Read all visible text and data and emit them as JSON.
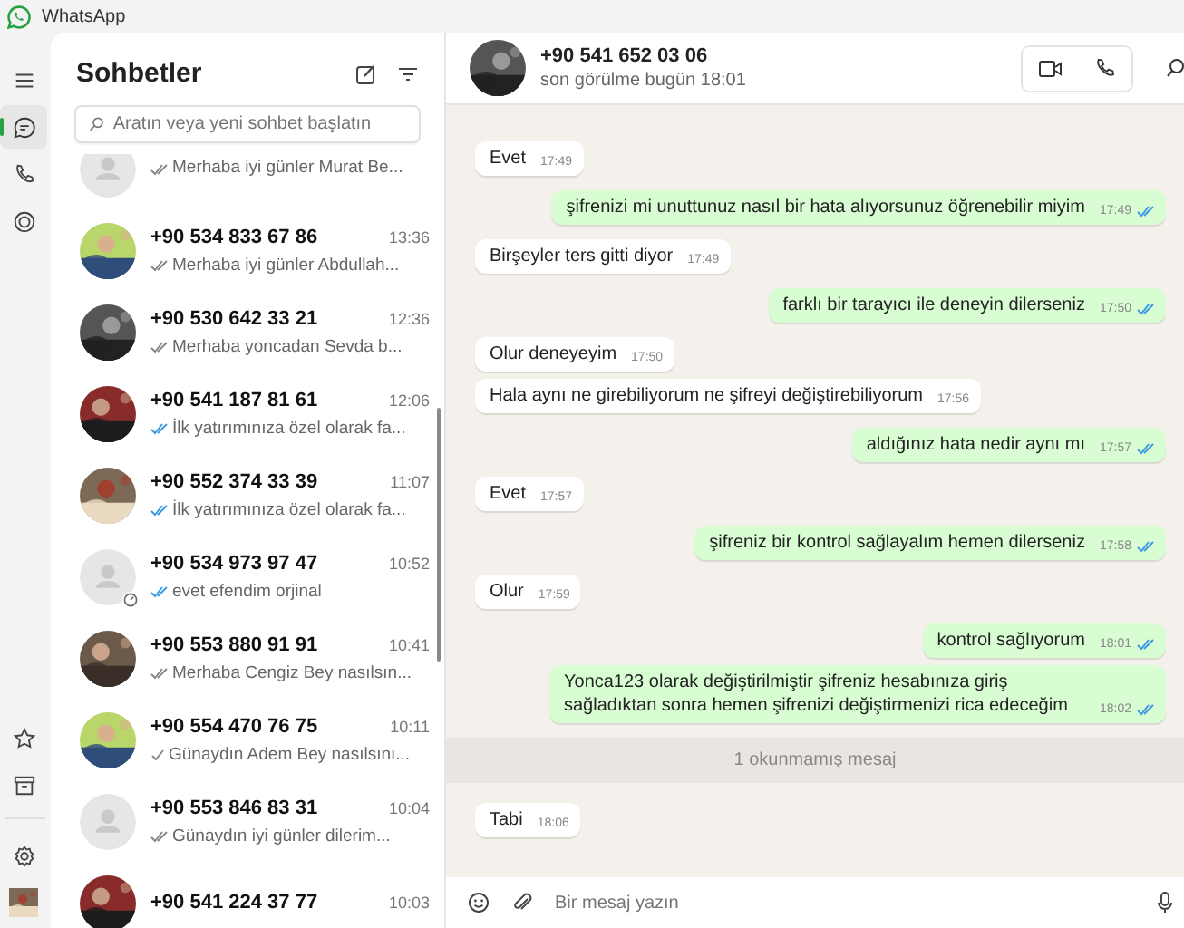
{
  "window": {
    "title": "WhatsApp"
  },
  "rail": {
    "top": [
      {
        "selected": false
      },
      {
        "selected": true
      },
      {
        "selected": false
      },
      {
        "selected": false
      }
    ],
    "bottom": [
      {
        "selected": false
      },
      {
        "selected": false
      },
      {
        "selected": false
      },
      {
        "selected": false
      }
    ]
  },
  "chat_list": {
    "title": "Sohbetler",
    "search": {
      "placeholder": "Aratın veya yeni sohbet başlatın"
    },
    "chats": [
      {
        "preview": "Merhaba iyi günler Murat Be...",
        "double_tick": true,
        "read": false,
        "disappearing": false
      },
      {
        "name": "+90 534 833 67 86",
        "time": "13:36",
        "preview": "Merhaba iyi günler Abdullah...",
        "double_tick": true,
        "read": false,
        "disappearing": false
      },
      {
        "name": "+90 530 642 33 21",
        "time": "12:36",
        "preview": "Merhaba yoncadan Sevda b...",
        "double_tick": true,
        "read": false,
        "disappearing": false
      },
      {
        "name": "+90 541 187 81 61",
        "time": "12:06",
        "preview": "İlk yatırımınıza özel olarak fa...",
        "double_tick": true,
        "read": true,
        "disappearing": false
      },
      {
        "name": "+90 552 374 33 39",
        "time": "11:07",
        "preview": "İlk yatırımınıza özel olarak fa...",
        "double_tick": true,
        "read": true,
        "disappearing": false
      },
      {
        "name": "+90 534 973 97 47",
        "time": "10:52",
        "preview": "evet efendim orjinal",
        "double_tick": true,
        "read": true,
        "disappearing": true
      },
      {
        "name": "+90 553 880 91 91",
        "time": "10:41",
        "preview": "Merhaba Cengiz Bey nasılsın...",
        "double_tick": true,
        "read": false,
        "disappearing": false
      },
      {
        "name": "+90 554 470 76 75",
        "time": "10:11",
        "preview": "Günaydın Adem Bey nasılsını...",
        "double_tick": false,
        "read": false,
        "disappearing": false
      },
      {
        "name": "+90 553 846 83 31",
        "time": "10:04",
        "preview": "Günaydın iyi günler dilerim...",
        "double_tick": true,
        "read": false,
        "disappearing": false
      },
      {
        "name": "+90 541 224 37 77",
        "time": "10:03",
        "disappearing": false
      }
    ]
  },
  "conversation": {
    "contact": {
      "name": "+90 541 652 03 06",
      "status": "son görülme bugün 18:01"
    },
    "messages": [
      {
        "kind": "incoming",
        "text": "Evet",
        "time": "17:49"
      },
      {
        "kind": "outgoing",
        "text": "şifrenizi mi unuttunuz nasıl bir hata alıyorsunuz öğrenebilir miyim",
        "time": "17:49",
        "read": true
      },
      {
        "kind": "incoming",
        "text": "Birşeyler ters gitti diyor",
        "time": "17:49"
      },
      {
        "kind": "outgoing",
        "text": "farklı bir tarayıcı ile deneyin dilerseniz",
        "time": "17:50",
        "read": true
      },
      {
        "kind": "incoming",
        "text": "Olur deneyeyim",
        "time": "17:50"
      },
      {
        "kind": "incoming",
        "text": "Hala aynı ne girebiliyorum ne şifreyi değiştirebiliyorum",
        "time": "17:56"
      },
      {
        "kind": "outgoing",
        "text": "aldığınız hata nedir aynı mı",
        "time": "17:57",
        "read": true
      },
      {
        "kind": "incoming",
        "text": "Evet",
        "time": "17:57"
      },
      {
        "kind": "outgoing",
        "text": "şifreniz bir kontrol sağlayalım hemen dilerseniz",
        "time": "17:58",
        "read": true
      },
      {
        "kind": "incoming",
        "text": "Olur",
        "time": "17:59"
      },
      {
        "kind": "outgoing",
        "text": "kontrol sağlıyorum",
        "time": "18:01",
        "read": true
      },
      {
        "kind": "outgoing",
        "text": "Yonca123 olarak değiştirilmiştir şifreniz hesabınıza giriş sağladıktan sonra hemen şifrenizi değiştirmenizi rica edeceğim",
        "time": "18:02",
        "read": true
      },
      {
        "kind": "divider",
        "text": "1 okunmamış mesaj"
      },
      {
        "kind": "incoming",
        "text": "Tabi",
        "time": "18:06"
      }
    ],
    "composer": {
      "placeholder": "Bir mesaj yazın"
    }
  }
}
